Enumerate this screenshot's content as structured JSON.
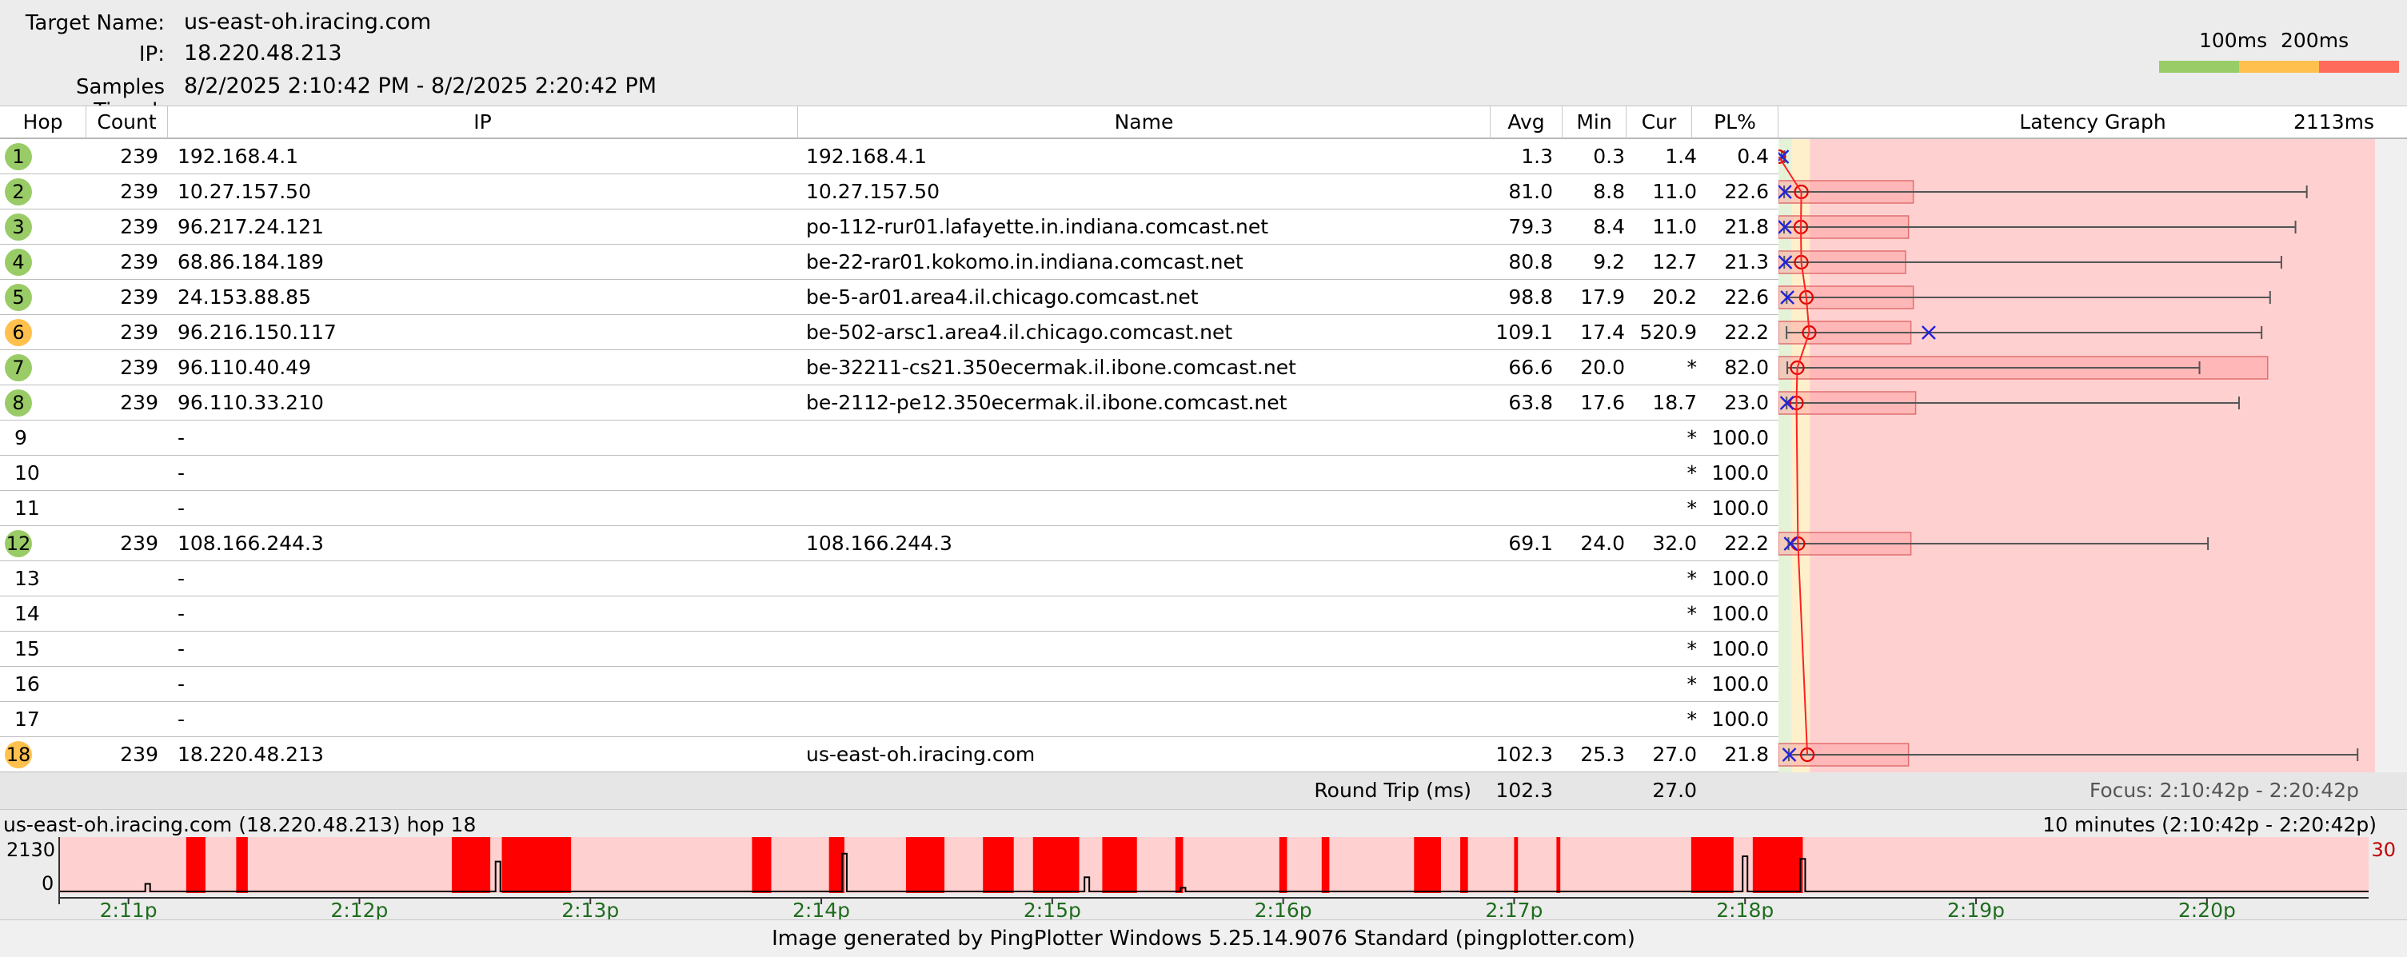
{
  "header": {
    "target_name_label": "Target Name:",
    "target_name": "us-east-oh.iracing.com",
    "ip_label": "IP:",
    "ip": "18.220.48.213",
    "samples_label": "Samples Timed:",
    "samples": "8/2/2025 2:10:42 PM - 8/2/2025 2:20:42 PM"
  },
  "legend": {
    "t1": "100ms",
    "t2": "200ms",
    "colors": [
      "#99cc66",
      "#ffc04d",
      "#ff6b5a"
    ]
  },
  "columns": {
    "hop": "Hop",
    "count": "Count",
    "ip": "IP",
    "name": "Name",
    "avg": "Avg",
    "min": "Min",
    "cur": "Cur",
    "pl": "PL%",
    "graph": "Latency Graph",
    "graph_max": "2113ms"
  },
  "hops": [
    {
      "hop": "1",
      "count": "239",
      "ip": "192.168.4.1",
      "name": "192.168.4.1",
      "avg": "1.3",
      "min": "0.3",
      "cur": "1.4",
      "pl": "0.4",
      "status": "green",
      "avg_ms": 1.3,
      "min_ms": 0.3,
      "cur_ms": 1.4,
      "max_ms": 10,
      "pl_val": 0.4
    },
    {
      "hop": "2",
      "count": "239",
      "ip": "10.27.157.50",
      "name": "10.27.157.50",
      "avg": "81.0",
      "min": "8.8",
      "cur": "11.0",
      "pl": "22.6",
      "status": "green",
      "avg_ms": 81.0,
      "min_ms": 8.8,
      "cur_ms": 11.0,
      "max_ms": 1860,
      "pl_val": 22.6
    },
    {
      "hop": "3",
      "count": "239",
      "ip": "96.217.24.121",
      "name": "po-112-rur01.lafayette.in.indiana.comcast.net",
      "avg": "79.3",
      "min": "8.4",
      "cur": "11.0",
      "pl": "21.8",
      "status": "green",
      "avg_ms": 79.3,
      "min_ms": 8.4,
      "cur_ms": 11.0,
      "max_ms": 1820,
      "pl_val": 21.8
    },
    {
      "hop": "4",
      "count": "239",
      "ip": "68.86.184.189",
      "name": "be-22-rar01.kokomo.in.indiana.comcast.net",
      "avg": "80.8",
      "min": "9.2",
      "cur": "12.7",
      "pl": "21.3",
      "status": "green",
      "avg_ms": 80.8,
      "min_ms": 9.2,
      "cur_ms": 12.7,
      "max_ms": 1770,
      "pl_val": 21.3
    },
    {
      "hop": "5",
      "count": "239",
      "ip": "24.153.88.85",
      "name": "be-5-ar01.area4.il.chicago.comcast.net",
      "avg": "98.8",
      "min": "17.9",
      "cur": "20.2",
      "pl": "22.6",
      "status": "green",
      "avg_ms": 98.8,
      "min_ms": 17.9,
      "cur_ms": 20.2,
      "max_ms": 1730,
      "pl_val": 22.6
    },
    {
      "hop": "6",
      "count": "239",
      "ip": "96.216.150.117",
      "name": "be-502-arsc1.area4.il.chicago.comcast.net",
      "avg": "109.1",
      "min": "17.4",
      "cur": "520.9",
      "pl": "22.2",
      "status": "orange",
      "avg_ms": 109.1,
      "min_ms": 17.4,
      "cur_ms": 520.9,
      "max_ms": 1700,
      "pl_val": 22.2
    },
    {
      "hop": "7",
      "count": "239",
      "ip": "96.110.40.49",
      "name": "be-32211-cs21.350ecermak.il.ibone.comcast.net",
      "avg": "66.6",
      "min": "20.0",
      "cur": "*",
      "pl": "82.0",
      "status": "green",
      "avg_ms": 66.6,
      "min_ms": 20.0,
      "cur_ms": null,
      "max_ms": 1480,
      "pl_val": 82.0
    },
    {
      "hop": "8",
      "count": "239",
      "ip": "96.110.33.210",
      "name": "be-2112-pe12.350ecermak.il.ibone.comcast.net",
      "avg": "63.8",
      "min": "17.6",
      "cur": "18.7",
      "pl": "23.0",
      "status": "green",
      "avg_ms": 63.8,
      "min_ms": 17.6,
      "cur_ms": 18.7,
      "max_ms": 1620,
      "pl_val": 23.0
    },
    {
      "hop": "9",
      "count": "",
      "ip": "-",
      "name": "",
      "avg": "",
      "min": "",
      "cur": "*",
      "pl": "100.0",
      "status": "none"
    },
    {
      "hop": "10",
      "count": "",
      "ip": "-",
      "name": "",
      "avg": "",
      "min": "",
      "cur": "*",
      "pl": "100.0",
      "status": "none"
    },
    {
      "hop": "11",
      "count": "",
      "ip": "-",
      "name": "",
      "avg": "",
      "min": "",
      "cur": "*",
      "pl": "100.0",
      "status": "none"
    },
    {
      "hop": "12",
      "count": "239",
      "ip": "108.166.244.3",
      "name": "108.166.244.3",
      "avg": "69.1",
      "min": "24.0",
      "cur": "32.0",
      "pl": "22.2",
      "status": "green",
      "avg_ms": 69.1,
      "min_ms": 24.0,
      "cur_ms": 32.0,
      "max_ms": 1510,
      "pl_val": 22.2
    },
    {
      "hop": "13",
      "count": "",
      "ip": "-",
      "name": "",
      "avg": "",
      "min": "",
      "cur": "*",
      "pl": "100.0",
      "status": "none"
    },
    {
      "hop": "14",
      "count": "",
      "ip": "-",
      "name": "",
      "avg": "",
      "min": "",
      "cur": "*",
      "pl": "100.0",
      "status": "none"
    },
    {
      "hop": "15",
      "count": "",
      "ip": "-",
      "name": "",
      "avg": "",
      "min": "",
      "cur": "*",
      "pl": "100.0",
      "status": "none"
    },
    {
      "hop": "16",
      "count": "",
      "ip": "-",
      "name": "",
      "avg": "",
      "min": "",
      "cur": "*",
      "pl": "100.0",
      "status": "none"
    },
    {
      "hop": "17",
      "count": "",
      "ip": "-",
      "name": "",
      "avg": "",
      "min": "",
      "cur": "*",
      "pl": "100.0",
      "status": "none"
    },
    {
      "hop": "18",
      "count": "239",
      "ip": "18.220.48.213",
      "name": "us-east-oh.iracing.com",
      "avg": "102.3",
      "min": "25.3",
      "cur": "27.0",
      "pl": "21.8",
      "status": "orange",
      "avg_ms": 102.3,
      "min_ms": 25.3,
      "cur_ms": 27.0,
      "max_ms": 2040,
      "pl_val": 21.8
    }
  ],
  "round_trip": {
    "label": "Round Trip (ms)",
    "avg": "102.3",
    "cur": "27.0",
    "focus": "Focus: 2:10:42p - 2:20:42p"
  },
  "colors": {
    "green": "#99cc66",
    "orange": "#ffc04d",
    "loss": "#ff0000",
    "graph_bg_high": "#ffd0d0",
    "graph_bg_mid": "#fff0cc",
    "graph_bg_low": "#e4f2d8"
  },
  "timeline": {
    "title": "us-east-oh.iracing.com (18.220.48.213) hop 18",
    "range": "10 minutes (2:10:42p - 2:20:42p)",
    "y_top": "2130",
    "y_bottom": "0",
    "loss_max": "30",
    "ticks": [
      "2:11p",
      "2:12p",
      "2:13p",
      "2:14p",
      "2:15p",
      "2:16p",
      "2:17p",
      "2:18p",
      "2:19p",
      "2:20p"
    ],
    "loss_periods": [
      [
        "2:11:15",
        "2:11:20"
      ],
      [
        "2:11:28",
        "2:11:31"
      ],
      [
        "2:12:24",
        "2:12:34"
      ],
      [
        "2:12:37",
        "2:12:55"
      ],
      [
        "2:13:42",
        "2:13:47"
      ],
      [
        "2:14:02",
        "2:14:06"
      ],
      [
        "2:14:22",
        "2:14:32"
      ],
      [
        "2:14:42",
        "2:14:50"
      ],
      [
        "2:14:55",
        "2:15:07"
      ],
      [
        "2:15:13",
        "2:15:22"
      ],
      [
        "2:15:32",
        "2:15:34"
      ],
      [
        "2:15:59",
        "2:16:01"
      ],
      [
        "2:16:10",
        "2:16:12"
      ],
      [
        "2:16:34",
        "2:16:41"
      ],
      [
        "2:16:46",
        "2:16:48"
      ],
      [
        "2:17:00",
        "2:17:01"
      ],
      [
        "2:17:11",
        "2:17:12"
      ],
      [
        "2:17:46",
        "2:17:57"
      ],
      [
        "2:18:02",
        "2:18:15"
      ]
    ],
    "latency_spikes": [
      [
        "2:11:05",
        350
      ],
      [
        "2:12:36",
        1200
      ],
      [
        "2:14:06",
        1500
      ],
      [
        "2:15:09",
        600
      ],
      [
        "2:15:34",
        200
      ],
      [
        "2:18:00",
        1400
      ],
      [
        "2:18:15",
        1300
      ]
    ]
  },
  "footer": "Image generated by PingPlotter Windows 5.25.14.9076 Standard (pingplotter.com)"
}
